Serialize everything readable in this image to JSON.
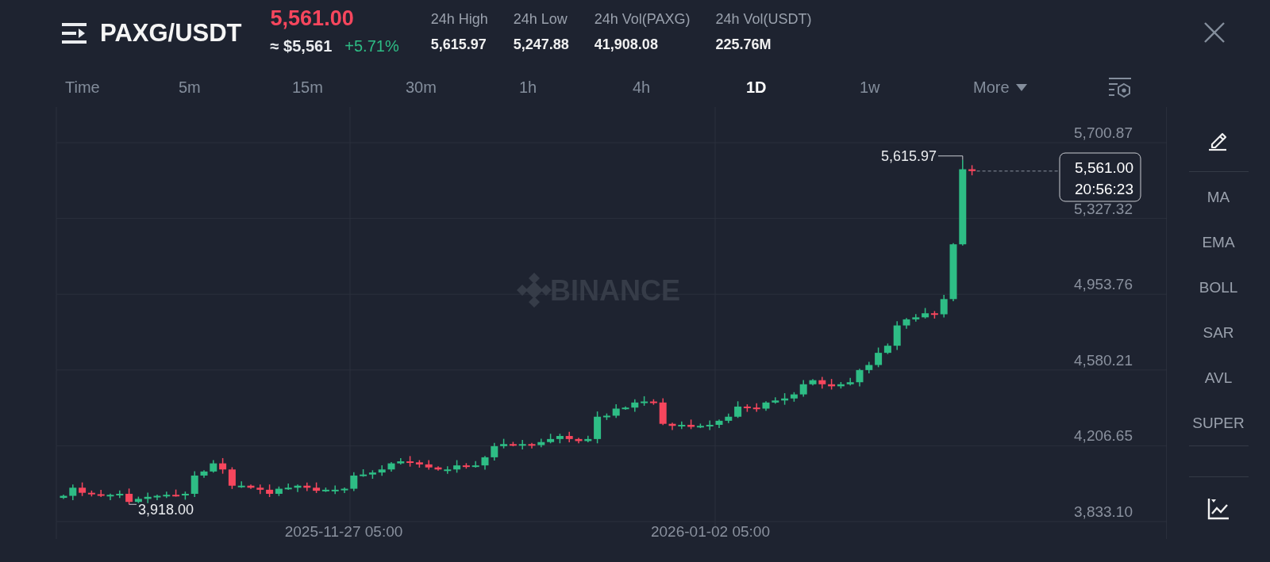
{
  "header": {
    "pair": "PAXG/USDT",
    "last_price": "5,561.00",
    "approx_usd": "≈ $5,561",
    "change": "+5.71%",
    "stats": [
      {
        "label": "24h High",
        "value": "5,615.97"
      },
      {
        "label": "24h Low",
        "value": "5,247.88"
      },
      {
        "label": "24h Vol(PAXG)",
        "value": "41,908.08"
      },
      {
        "label": "24h Vol(USDT)",
        "value": "225.76M"
      }
    ]
  },
  "intervals": [
    {
      "label": "Time",
      "selected": false,
      "kind": "tab"
    },
    {
      "label": "5m",
      "selected": false,
      "kind": "tab"
    },
    {
      "label": "15m",
      "selected": false,
      "kind": "tab"
    },
    {
      "label": "30m",
      "selected": false,
      "kind": "tab"
    },
    {
      "label": "1h",
      "selected": false,
      "kind": "tab"
    },
    {
      "label": "4h",
      "selected": false,
      "kind": "tab"
    },
    {
      "label": "1D",
      "selected": true,
      "kind": "tab"
    },
    {
      "label": "1w",
      "selected": false,
      "kind": "tab"
    },
    {
      "label": "More",
      "selected": false,
      "kind": "dropdown"
    }
  ],
  "chart": {
    "watermark": "BINANCE",
    "y_labels": [
      "5,700.87",
      "5,327.32",
      "4,953.76",
      "4,580.21",
      "4,206.65",
      "3,833.10"
    ],
    "x_labels": [
      "2025-11-27 05:00",
      "2026-01-02 05:00"
    ],
    "high_marker": "5,615.97",
    "low_marker": "3,918.00",
    "price_tag": {
      "price": "5,561.00",
      "countdown": "20:56:23"
    }
  },
  "indicators": [
    "MA",
    "EMA",
    "BOLL",
    "SAR",
    "AVL",
    "SUPER"
  ]
}
